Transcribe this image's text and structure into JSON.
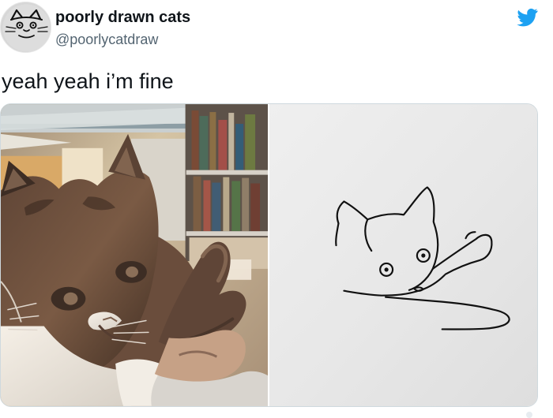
{
  "tweet": {
    "display_name": "poorly drawn cats",
    "handle": "@poorlycatdraw",
    "text": "yeah yeah i’m fine"
  },
  "icons": {
    "avatar": "avatar",
    "platform": "twitter-bird-icon"
  },
  "colors": {
    "twitter_blue": "#1DA1F2",
    "text": "#0F1419",
    "handle": "#536471",
    "border": "#CFD9DE"
  }
}
